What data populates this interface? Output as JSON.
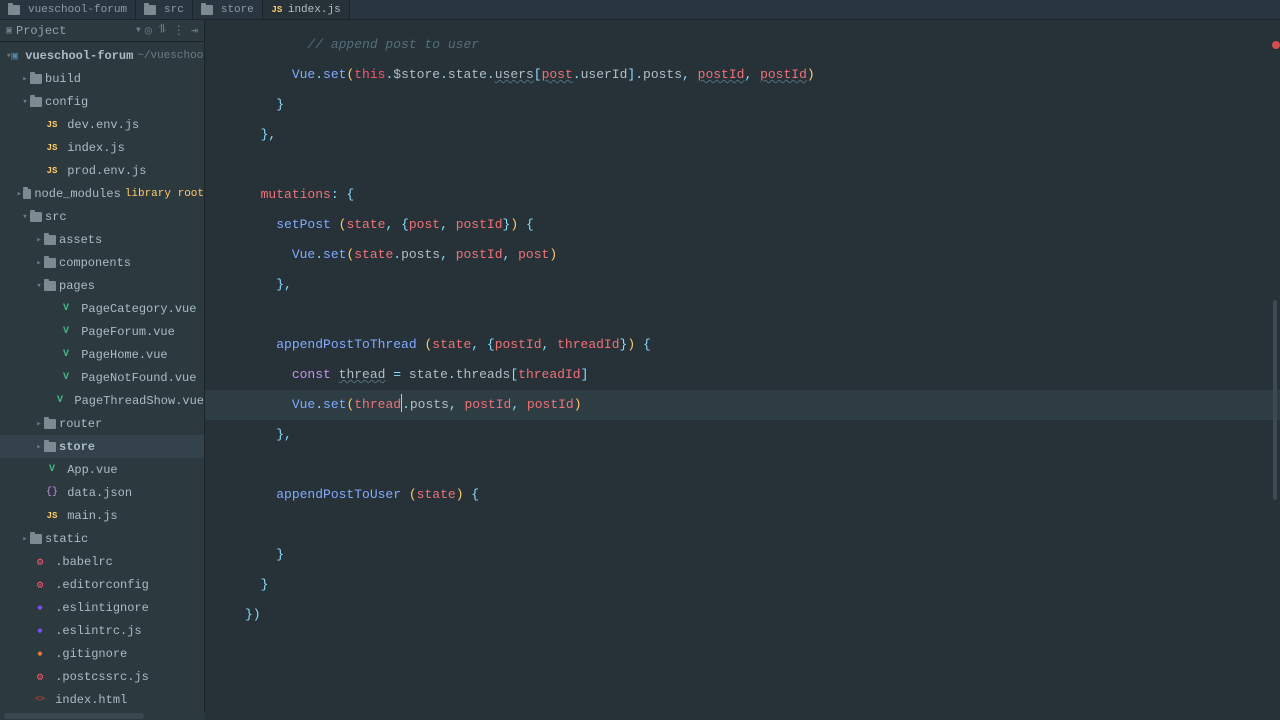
{
  "breadcrumbs": [
    {
      "label": "vueschool-forum",
      "icon": "folder"
    },
    {
      "label": "src",
      "icon": "folder"
    },
    {
      "label": "store",
      "icon": "folder"
    },
    {
      "label": "index.js",
      "icon": "js"
    }
  ],
  "project_selector": "Project",
  "tree": {
    "root": {
      "name": "vueschool-forum",
      "path": "~/vueschool/v"
    },
    "build": "build",
    "config": "config",
    "dev_env": "dev.env.js",
    "index_js": "index.js",
    "prod_env": "prod.env.js",
    "node_modules": "node_modules",
    "library_root": "library root",
    "src": "src",
    "assets": "assets",
    "components": "components",
    "pages": "pages",
    "page_category": "PageCategory.vue",
    "page_forum": "PageForum.vue",
    "page_home": "PageHome.vue",
    "page_notfound": "PageNotFound.vue",
    "page_threadshow": "PageThreadShow.vue",
    "router": "router",
    "store": "store",
    "app_vue": "App.vue",
    "data_json": "data.json",
    "main_js": "main.js",
    "static": "static",
    "babelrc": ".babelrc",
    "editorconfig": ".editorconfig",
    "eslintignore": ".eslintignore",
    "eslintrc": ".eslintrc.js",
    "gitignore": ".gitignore",
    "postcssrc": ".postcssrc.js",
    "index_html": "index.html"
  },
  "code": {
    "l1_comment": "// append post to user",
    "l2_vue": "Vue",
    "l2_set": "set",
    "l2_this": "this",
    "l2_store": "$store",
    "l2_state": "state",
    "l2_users": "users",
    "l2_post": "post",
    "l2_userId": "userId",
    "l2_posts": "posts",
    "l2_postId1": "postId",
    "l2_postId2": "postId",
    "mutations": "mutations",
    "setPost": "setPost",
    "sp_state": "state",
    "sp_post": "post",
    "sp_postId": "postId",
    "sp_body_vue": "Vue",
    "sp_body_set": "set",
    "sp_body_stateposts": "state",
    "sp_body_posts": "posts",
    "sp_body_postId": "postId",
    "sp_body_post": "post",
    "appT": "appendPostToThread",
    "at_state": "state",
    "at_postId": "postId",
    "at_threadId": "threadId",
    "at_const": "const",
    "at_thread": "thread",
    "at_eq": "=",
    "at_state2": "state",
    "at_threads": "threads",
    "at_threadId2": "threadId",
    "at_vue": "Vue",
    "at_set": "set",
    "at_thread2": "thread",
    "at_posts": "posts",
    "at_postId2": "postId",
    "at_postId3": "postId",
    "appU": "appendPostToUser",
    "au_state": "state"
  }
}
